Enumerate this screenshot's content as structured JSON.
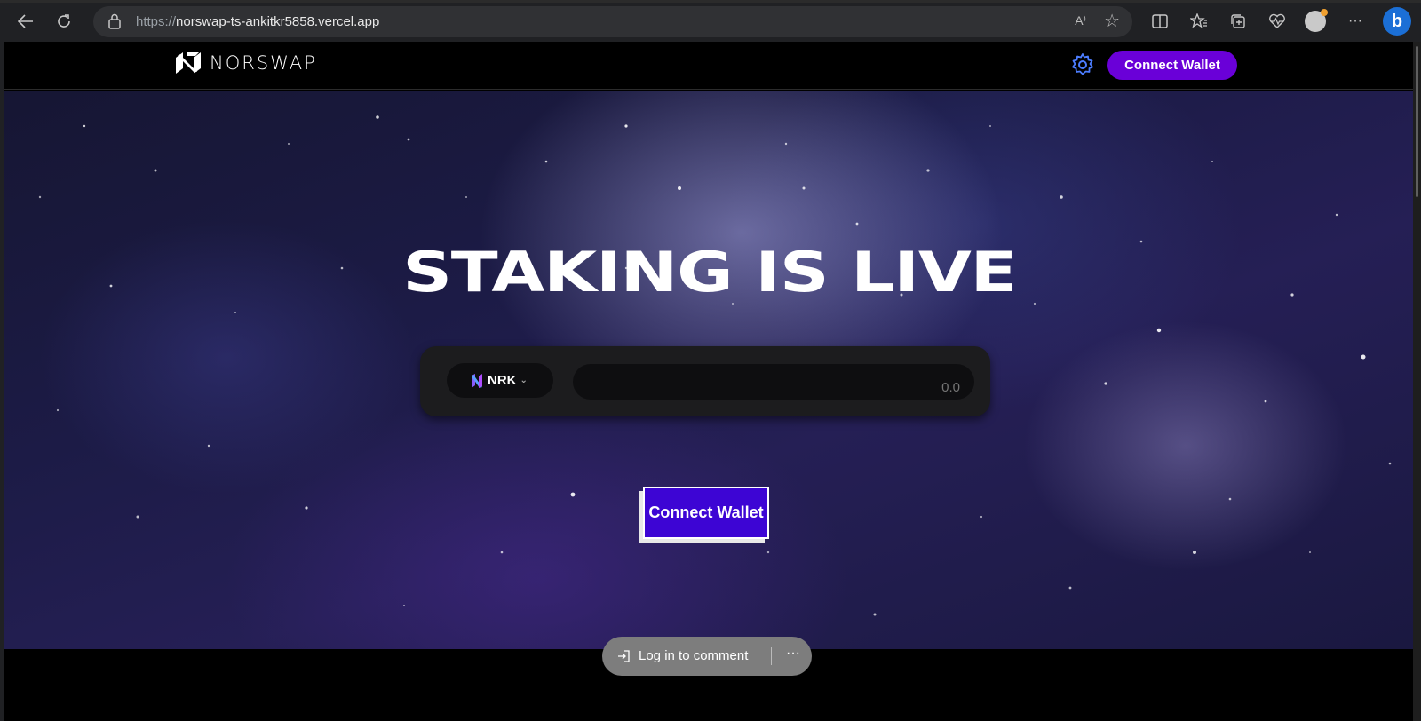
{
  "browser": {
    "url_protocol": "https://",
    "url_host": "norswap-ts-ankitkr5858.vercel.app",
    "read_aloud_label": "A⁾",
    "icons": [
      "back-icon",
      "refresh-icon",
      "lock-icon",
      "read-aloud-icon",
      "favorite-star-icon",
      "split-screen-icon",
      "favorites-icon",
      "collections-icon",
      "health-icon",
      "profile-avatar",
      "more-icon",
      "bing-icon"
    ]
  },
  "nav": {
    "logo_text": "NORSWAP",
    "connect_label": "Connect Wallet"
  },
  "hero": {
    "headline": "STAKING IS LIVE",
    "token_label": "NRK",
    "amount_placeholder": "0.0",
    "connect_label": "Connect Wallet"
  },
  "comment": {
    "label": "Log in to comment",
    "more_label": "···"
  },
  "colors": {
    "accent": "#6a00d8",
    "connect_main": "#3d05d4",
    "gear": "#4c7dff"
  }
}
